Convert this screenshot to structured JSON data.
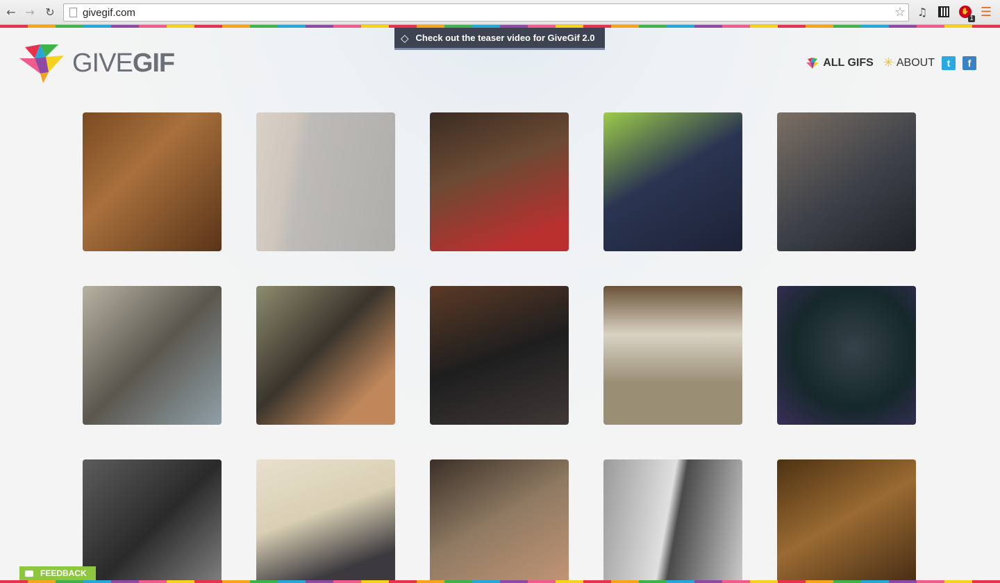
{
  "browser": {
    "url": "givegif.com"
  },
  "teaser": {
    "text": "Check out the teaser video for GiveGif 2.0"
  },
  "logo": {
    "text_light": "GIVE",
    "text_bold": "GIF"
  },
  "nav": {
    "all_gifs": "ALL GIFS",
    "about": "ABOUT",
    "twitter": "t",
    "facebook": "f"
  },
  "feedback": {
    "label": "FEEDBACK"
  },
  "gifs": [
    {
      "bg": "linear-gradient(135deg,#7a4a22,#a8703c 40%,#5a3418)"
    },
    {
      "bg": "linear-gradient(100deg,#d9d1c6 0%,#cfc6bd 25%,#bdbab7 35%,#b0aeab)"
    },
    {
      "bg": "linear-gradient(160deg,#3b2c23,#6b4a33 40%,#b9302f 85%)"
    },
    {
      "bg": "linear-gradient(150deg,#9ccc4a,#2b3552 45%,#1c2236)"
    },
    {
      "bg": "linear-gradient(145deg,#7b6f63,#3c4048 55%,#1f2228)"
    },
    {
      "bg": "linear-gradient(135deg,#b7b2a2,#5b574f 50%,#8fa0a8)"
    },
    {
      "bg": "linear-gradient(135deg,#8e8c6e,#3a342c 45%,#c0875b 80%)"
    },
    {
      "bg": "linear-gradient(160deg,#5b3a26,#1e1e1e 50%,#3f3836)"
    },
    {
      "bg": "linear-gradient(180deg,#6b5238,#d9d3c4 35%,#9a8e75 70%)"
    },
    {
      "bg": "radial-gradient(circle at 55% 45%,#36424a,#15282a 55%,#3a2e5a)"
    },
    {
      "bg": "linear-gradient(135deg,#5c5c5c,#2a2a2a 50%,#8a8a8a)"
    },
    {
      "bg": "linear-gradient(160deg,#e8e0cc,#d9cfb4 40%,#3c3a3e 75%)"
    },
    {
      "bg": "linear-gradient(150deg,#3b3028,#8f7a62 45%,#c99878)"
    },
    {
      "bg": "linear-gradient(100deg,#9a9a9a,#e0e0e0 45%,#4a4a4a 52%,#cfcfcf)"
    },
    {
      "bg": "linear-gradient(150deg,#4d3212,#9a6a32 45%,#3a2410)"
    }
  ]
}
